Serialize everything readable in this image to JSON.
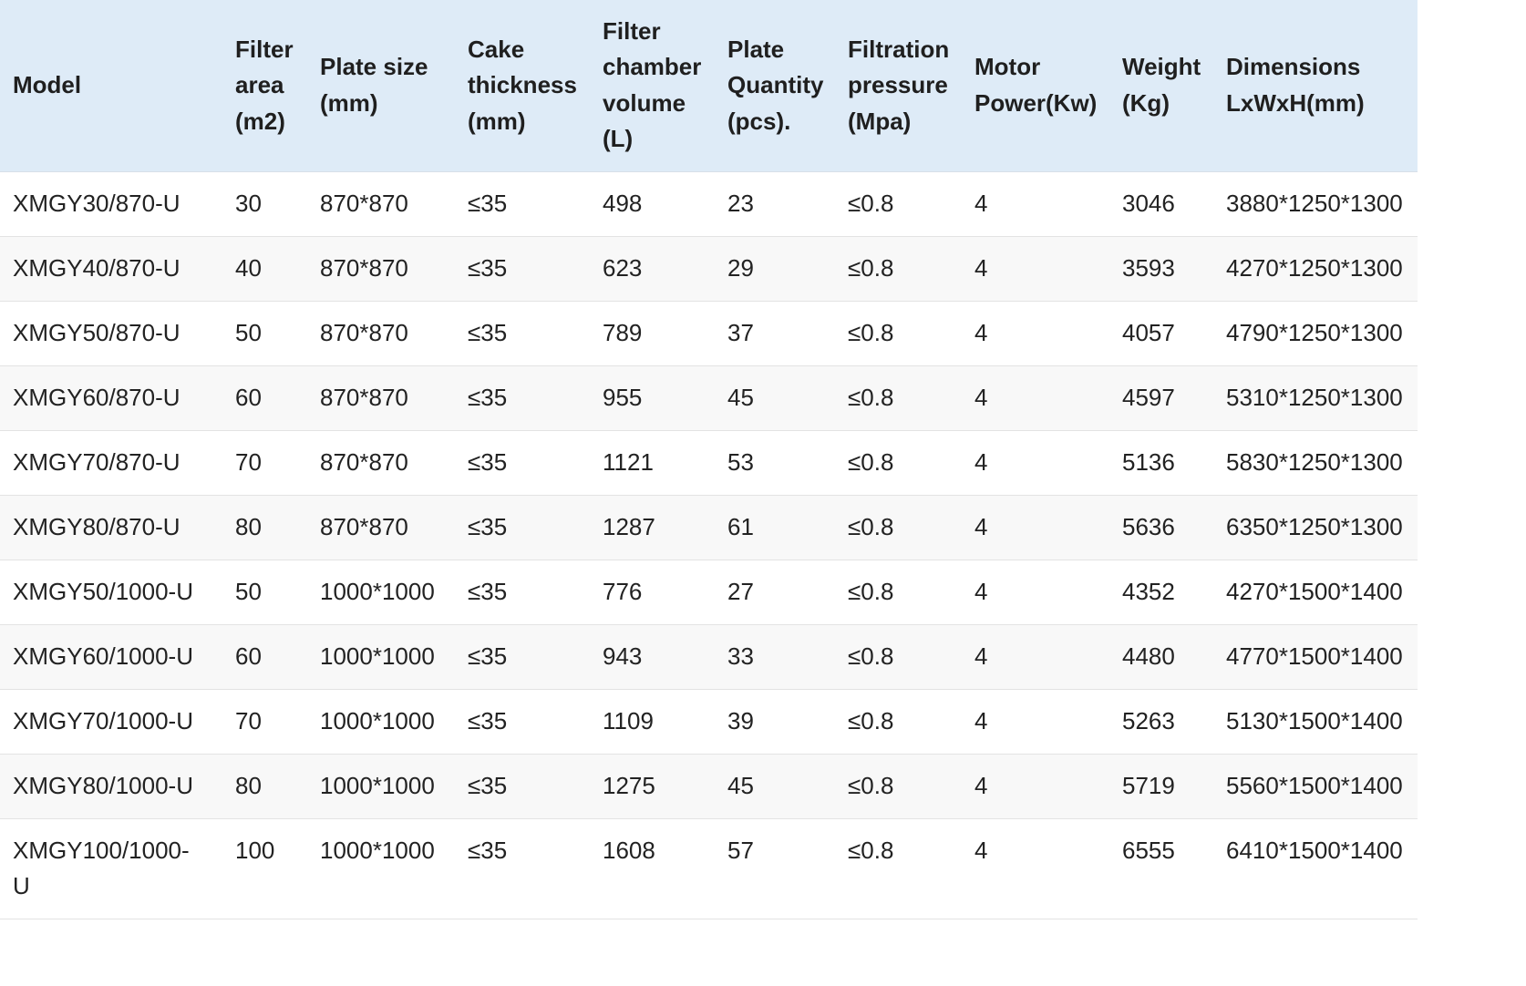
{
  "table": {
    "headers": [
      "Model",
      "Filter area (m2)",
      "Plate size (mm)",
      "Cake thickness (mm)",
      "Filter chamber volume (L)",
      "Plate Quantity (pcs).",
      "Filtration pressure (Mpa)",
      "Motor Power(Kw)",
      "Weight (Kg)",
      "Dimensions LxWxH(mm)"
    ],
    "header_lines": [
      [
        "Model"
      ],
      [
        "Filter",
        "area",
        "(m2)"
      ],
      [
        "Plate size",
        "(mm)"
      ],
      [
        "Cake",
        "thickness",
        "(mm)"
      ],
      [
        "Filter",
        "chamber",
        "volume",
        "(L)"
      ],
      [
        "Plate",
        "Quantity",
        "(pcs)."
      ],
      [
        "Filtration",
        "pressure",
        "(Mpa)"
      ],
      [
        "Motor",
        "Power(Kw)"
      ],
      [
        "Weight",
        "(Kg)"
      ],
      [
        "Dimensions",
        "LxWxH(mm)"
      ]
    ],
    "rows": [
      [
        "XMGY30/870-U",
        "30",
        "870*870",
        "≤35",
        "498",
        "23",
        "≤0.8",
        "4",
        "3046",
        "3880*1250*1300"
      ],
      [
        "XMGY40/870-U",
        "40",
        "870*870",
        "≤35",
        "623",
        "29",
        "≤0.8",
        "4",
        "3593",
        "4270*1250*1300"
      ],
      [
        "XMGY50/870-U",
        "50",
        "870*870",
        "≤35",
        "789",
        "37",
        "≤0.8",
        "4",
        "4057",
        "4790*1250*1300"
      ],
      [
        "XMGY60/870-U",
        "60",
        "870*870",
        "≤35",
        "955",
        "45",
        "≤0.8",
        "4",
        "4597",
        "5310*1250*1300"
      ],
      [
        "XMGY70/870-U",
        "70",
        "870*870",
        "≤35",
        "1121",
        "53",
        "≤0.8",
        "4",
        "5136",
        "5830*1250*1300"
      ],
      [
        "XMGY80/870-U",
        "80",
        "870*870",
        "≤35",
        "1287",
        "61",
        "≤0.8",
        "4",
        "5636",
        "6350*1250*1300"
      ],
      [
        "XMGY50/1000-U",
        "50",
        "1000*1000",
        "≤35",
        "776",
        "27",
        "≤0.8",
        "4",
        "4352",
        "4270*1500*1400"
      ],
      [
        "XMGY60/1000-U",
        "60",
        "1000*1000",
        "≤35",
        "943",
        "33",
        "≤0.8",
        "4",
        "4480",
        "4770*1500*1400"
      ],
      [
        "XMGY70/1000-U",
        "70",
        "1000*1000",
        "≤35",
        "1109",
        "39",
        "≤0.8",
        "4",
        "5263",
        "5130*1500*1400"
      ],
      [
        "XMGY80/1000-U",
        "80",
        "1000*1000",
        "≤35",
        "1275",
        "45",
        "≤0.8",
        "4",
        "5719",
        "5560*1500*1400"
      ],
      [
        "XMGY100/1000-U",
        "100",
        "1000*1000",
        "≤35",
        "1608",
        "57",
        "≤0.8",
        "4",
        "6555",
        "6410*1500*1400"
      ]
    ]
  }
}
